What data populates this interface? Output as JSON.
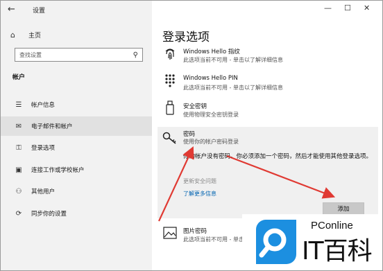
{
  "window": {
    "title": "设置"
  },
  "nav": {
    "home": "主页",
    "search_placeholder": "查找设置",
    "section": "帐户",
    "items": [
      {
        "label": "帐户信息",
        "icon": "person-info-icon"
      },
      {
        "label": "电子邮件和帐户",
        "icon": "mail-icon"
      },
      {
        "label": "登录选项",
        "icon": "key-icon"
      },
      {
        "label": "连接工作或学校帐户",
        "icon": "briefcase-icon"
      },
      {
        "label": "其他用户",
        "icon": "person-add-icon"
      },
      {
        "label": "同步你的设置",
        "icon": "sync-icon"
      }
    ],
    "active_index": 1
  },
  "page": {
    "title": "登录选项",
    "options": [
      {
        "title": "Windows Hello 指纹",
        "subtitle": "此选项当前不可用 - 单击以了解详细信息",
        "icon": "fingerprint-icon"
      },
      {
        "title": "Windows Hello PIN",
        "subtitle": "此选项当前不可用 - 单击以了解详细信息",
        "icon": "keypad-icon"
      },
      {
        "title": "安全密钥",
        "subtitle": "使用物理安全密钥登录",
        "icon": "usb-key-icon"
      },
      {
        "title": "密码",
        "subtitle": "使用你的帐户密码登录",
        "icon": "password-key-icon"
      },
      {
        "title": "图片密码",
        "subtitle": "此选项当前不可用 - 单击以了解详细信息",
        "icon": "picture-icon"
      }
    ],
    "password_detail": "你的帐户没有密码。你必须添加一个密码，然后才能使用其他登录选项。",
    "change_security_questions": "更新安全问题",
    "learn_more": "了解更多信息",
    "add_button": "添加"
  },
  "watermark": {
    "brand": "PConline",
    "name": "IT百科"
  },
  "colors": {
    "accent": "#0063b1",
    "arrow": "#e03a33"
  }
}
